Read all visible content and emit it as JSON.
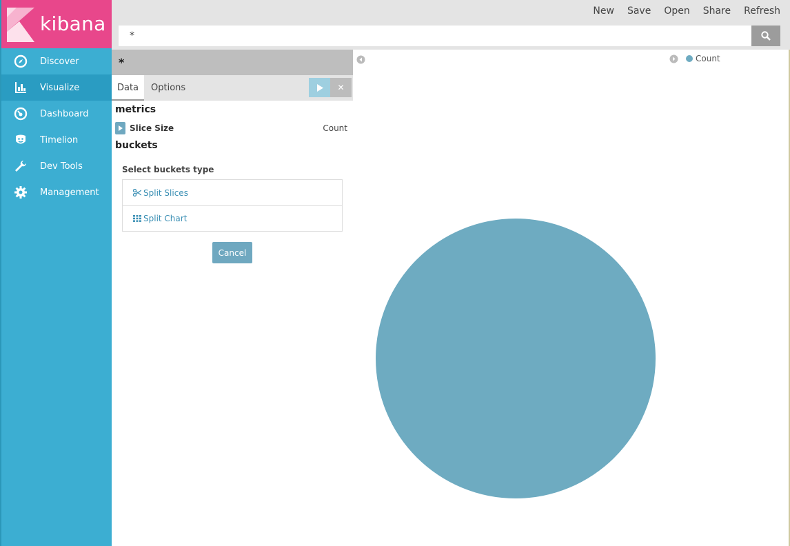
{
  "app": {
    "logo_text": "kibana"
  },
  "sidebar": {
    "items": [
      {
        "label": "Discover",
        "icon": "compass-icon"
      },
      {
        "label": "Visualize",
        "icon": "bar-chart-icon"
      },
      {
        "label": "Dashboard",
        "icon": "dashboard-icon"
      },
      {
        "label": "Timelion",
        "icon": "timelion-icon"
      },
      {
        "label": "Dev Tools",
        "icon": "wrench-icon"
      },
      {
        "label": "Management",
        "icon": "gear-icon"
      }
    ],
    "active": "Visualize"
  },
  "topmenu": {
    "new": "New",
    "save": "Save",
    "open": "Open",
    "share": "Share",
    "refresh": "Refresh"
  },
  "search": {
    "value": "*"
  },
  "editor": {
    "index_pattern": "*",
    "tabs": {
      "data": "Data",
      "options": "Options"
    },
    "metrics_title": "metrics",
    "metric": {
      "label": "Slice Size",
      "value": "Count"
    },
    "buckets_title": "buckets",
    "bucket_type_label": "Select buckets type",
    "bucket_options": [
      "Split Slices",
      "Split Chart"
    ],
    "cancel": "Cancel"
  },
  "visualization": {
    "legend_label": "Count",
    "colors": {
      "slice": "#6eabc1"
    }
  },
  "chart_data": {
    "type": "pie",
    "categories": [
      "Count"
    ],
    "values": [
      100
    ],
    "title": "",
    "legend_placement": "top-right"
  },
  "colors": {
    "sidebar": "#3caed2",
    "logo_bg": "#e8478b",
    "active_nav": "#2a9cc2",
    "accent": "#6fa8c0"
  }
}
